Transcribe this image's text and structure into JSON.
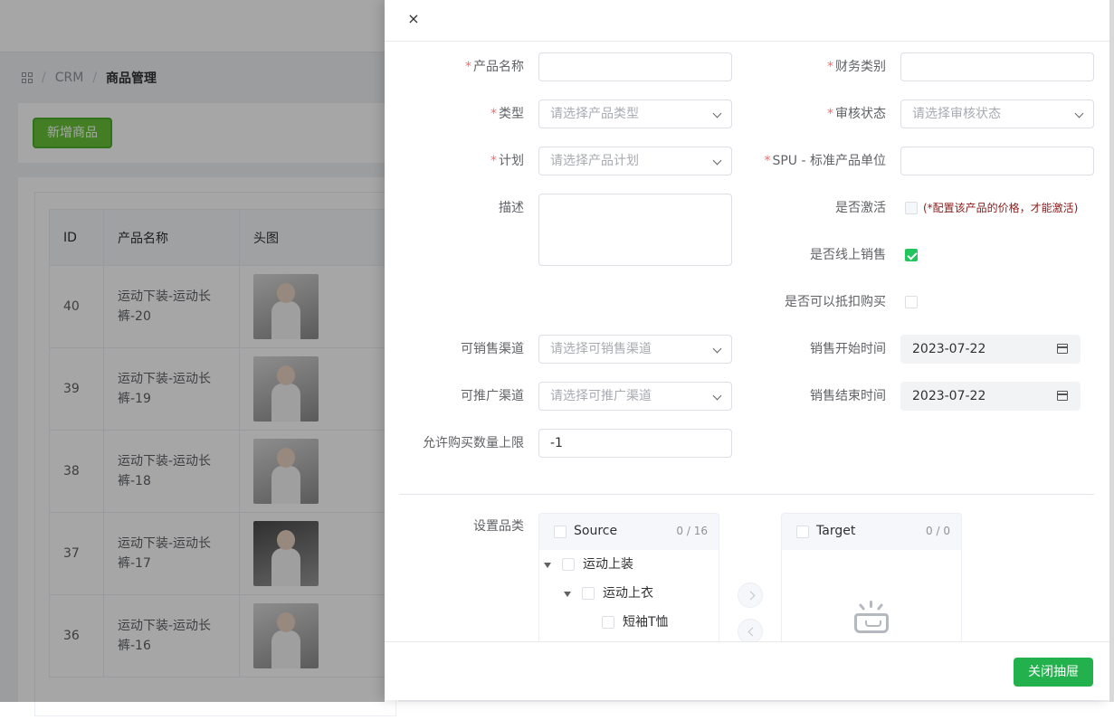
{
  "background": {
    "breadcrumb": [
      "CRM",
      "商品管理"
    ],
    "add_button": "新增商品",
    "table": {
      "headers": [
        "ID",
        "产品名称",
        "头图"
      ],
      "rows": [
        {
          "id": "40",
          "name": "运动下装-运动长裤-20"
        },
        {
          "id": "39",
          "name": "运动下装-运动长裤-19"
        },
        {
          "id": "38",
          "name": "运动下装-运动长裤-18"
        },
        {
          "id": "37",
          "name": "运动下装-运动长裤-17"
        },
        {
          "id": "36",
          "name": "运动下装-运动长裤-16"
        }
      ]
    }
  },
  "drawer": {
    "close_icon": "×",
    "fields": {
      "product_name": {
        "label": "产品名称",
        "value": ""
      },
      "finance_category": {
        "label": "财务类别",
        "value": ""
      },
      "type": {
        "label": "类型",
        "placeholder": "请选择产品类型"
      },
      "review_status": {
        "label": "审核状态",
        "placeholder": "请选择审核状态"
      },
      "plan": {
        "label": "计划",
        "placeholder": "请选择产品计划"
      },
      "spu": {
        "label": "SPU - 标准产品单位",
        "value": ""
      },
      "description": {
        "label": "描述",
        "value": ""
      },
      "is_active": {
        "label": "是否激活",
        "checked": false,
        "hint": "(*配置该产品的价格，才能激活)"
      },
      "online_sale": {
        "label": "是否线上销售",
        "checked": true
      },
      "deductible": {
        "label": "是否可以抵扣购买",
        "checked": false
      },
      "sale_channel": {
        "label": "可销售渠道",
        "placeholder": "请选择可销售渠道"
      },
      "sale_start": {
        "label": "销售开始时间",
        "value": "2023-07-22"
      },
      "promo_channel": {
        "label": "可推广渠道",
        "placeholder": "请选择可推广渠道"
      },
      "sale_end": {
        "label": "销售结束时间",
        "value": "2023-07-22"
      },
      "purchase_limit": {
        "label": "允许购买数量上限",
        "value": "-1"
      }
    },
    "category": {
      "label": "设置品类",
      "source": {
        "title": "Source",
        "count": "0 / 16",
        "items": [
          "运动上装",
          "运动上衣",
          "短袖T恤"
        ]
      },
      "target": {
        "title": "Target",
        "count": "0 / 0"
      }
    },
    "footer": {
      "close_button": "关闭抽屉"
    },
    "colors": {
      "primary": "#22b14c",
      "required": "#f56c6c",
      "hint": "#8b1a1a"
    }
  }
}
